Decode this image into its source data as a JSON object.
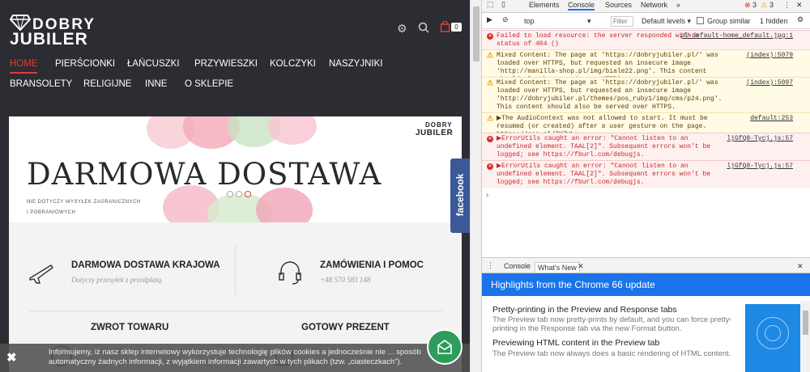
{
  "site": {
    "logo": {
      "line1": "DOBRY",
      "line2": "JUBILER"
    },
    "cart_count": "0",
    "nav": [
      "HOME",
      "PIERŚCIONKI",
      "ŁAŃCUSZKI",
      "PRZYWIESZKI",
      "KOLCZYKI",
      "NASZYJNIKI",
      "BRANSOLETY",
      "RELIGIJNE",
      "INNE",
      "O SKLEPIE"
    ],
    "banner": {
      "logo_line1": "DOBRY",
      "logo_line2": "JUBILER",
      "headline": "DARMOWA DOSTAWA",
      "sub1": "NIE DOTYCZY WYSYŁEK ZAGRANICZNYCH",
      "sub2": "I POBRANIOWYCH"
    },
    "features": [
      {
        "title": "DARMOWA DOSTAWA KRAJOWA",
        "sub": "Dotyczy przesyłek z przedpłatą.",
        "icon": "airplane-icon"
      },
      {
        "title": "ZAMÓWIENIA I POMOC",
        "sub": "+48 570 583 148",
        "icon": "headset-icon"
      },
      {
        "title": "ZWROT TOWARU",
        "icon": "return-icon"
      },
      {
        "title": "GOTOWY PREZENT",
        "icon": "gift-icon"
      }
    ],
    "facebook_label": "facebook",
    "cookie_text": "Informujemy, iż nasz sklep internetowy wykorzystuje technologię plików cookies a jednocześnie nie ... sposób automatyczny żadnych informacji, z wyjątkiem informacji zawartych w tych plikach (tzw. „ciasteczkach\").",
    "colors": {
      "accent": "#e53935",
      "header_bg": "#2b2d33",
      "facebook": "#3b5998",
      "chat": "#2e9c5a"
    }
  },
  "devtools": {
    "tabs": [
      "Elements",
      "Console",
      "Sources",
      "Network"
    ],
    "active_tab": "Console",
    "error_count": "3",
    "warning_count": "3",
    "context": "top",
    "filter_placeholder": "Filter",
    "levels": "Default levels ▾",
    "group_similar": "Group similar",
    "hidden_count": "1 hidden",
    "messages": [
      {
        "level": "error",
        "text": "Failed to load resource: the server responded with a status of 404 ()",
        "source": "pl-default-home_default.jpg:1"
      },
      {
        "level": "warning",
        "text": "Mixed Content: The page at 'https://dobryjubiler.pl/' was loaded over HTTPS, but requested an insecure image 'http://manilla-shop.pl/img/biale22.png'. This content should also be served over HTTPS.",
        "source": "(index):5079"
      },
      {
        "level": "warning",
        "text": "Mixed Content: The page at 'https://dobryjubiler.pl/' was loaded over HTTPS, but requested an insecure image 'http://dobryjubiler.pl/themes/pos_ruby1/img/cms/p24.png'. This content should also be served over HTTPS.",
        "source": "(index):5097"
      },
      {
        "level": "warning",
        "text": "▶The AudioContext was not allowed to start. It must be resumed (or created) after a user gesture on the page. https://goo.gl/7K7WLu",
        "source": "default:253"
      },
      {
        "level": "error",
        "text": "▶ErrorUtils caught an error: \"Cannot listen to an undefined element. TAAL[2]\". Subsequent errors won't be logged; see https://fburl.com/debugjs.",
        "source": "ljGfQ8-Tycj.js:57"
      },
      {
        "level": "error",
        "text": "▶ErrorUtils caught an error: \"Cannot listen to an undefined element. TAAL[2]\". Subsequent errors won't be logged; see https://fburl.com/debugjs.",
        "source": "ljGfQ8-Tycj.js:57"
      }
    ],
    "drawer_tabs": [
      "Console",
      "What's New"
    ],
    "highlights_title": "Highlights from the Chrome 66 update",
    "whats_new": [
      {
        "title": "Pretty-printing in the Preview and Response tabs",
        "desc": "The Preview tab now pretty-prints by default, and you can force pretty-printing in the Response tab via the new Format button."
      },
      {
        "title": "Previewing HTML content in the Preview tab",
        "desc": "The Preview tab now always does a basic rendering of HTML content."
      }
    ],
    "colors": {
      "highlight_bar": "#1a73e8",
      "error": "#c62828",
      "warning": "#e6a400"
    }
  }
}
